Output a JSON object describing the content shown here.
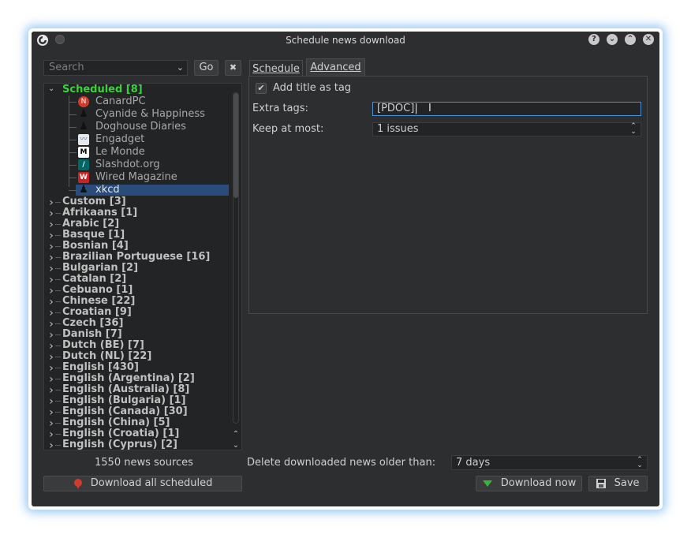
{
  "window": {
    "title": "Schedule news download"
  },
  "titlebar": {
    "help": "?",
    "minimize": "⌄",
    "maximize": "⌃",
    "close": "✕"
  },
  "search": {
    "placeholder": "Search",
    "go_label": "Go",
    "clear_label": "✖"
  },
  "tabs": [
    {
      "label": "Schedule"
    },
    {
      "label": "Advanced"
    }
  ],
  "advanced": {
    "add_title_label": "Add title as tag",
    "add_title_checked": true,
    "extra_tags_label": "Extra  tags:",
    "extra_tags_value": "[PDOC]",
    "keep_at_most_label": "Keep at most:",
    "keep_at_most_value": "1 issues"
  },
  "tree": {
    "scheduled": {
      "label": "Scheduled [8]",
      "items": [
        {
          "label": "CanardPC",
          "icon": "canardpc-icon",
          "color": "#d23b2c"
        },
        {
          "label": "Cyanide & Happiness",
          "icon": "user-icon",
          "color": "#1a1a1a"
        },
        {
          "label": "Doghouse Diaries",
          "icon": "user-icon",
          "color": "#1a1a1a"
        },
        {
          "label": "Engadget",
          "icon": "rss-icon",
          "color": "#e8e8e8"
        },
        {
          "label": "Le Monde",
          "icon": "lemonde-icon",
          "color": "#ffffff"
        },
        {
          "label": "Slashdot.org",
          "icon": "slashdot-icon",
          "color": "#006666"
        },
        {
          "label": "Wired Magazine",
          "icon": "wired-icon",
          "color": "#cc2222"
        },
        {
          "label": "xkcd",
          "icon": "user-icon",
          "color": "#1a1a1a",
          "selected": true
        }
      ]
    },
    "categories": [
      "Custom [3]",
      "Afrikaans [1]",
      "Arabic [2]",
      "Basque [1]",
      "Bosnian [4]",
      "Brazilian Portuguese [16]",
      "Bulgarian [2]",
      "Catalan [2]",
      "Cebuano [1]",
      "Chinese [22]",
      "Croatian [9]",
      "Czech [36]",
      "Danish [7]",
      "Dutch (BE) [7]",
      "Dutch (NL) [22]",
      "English [430]",
      "English (Argentina) [2]",
      "English (Australia) [8]",
      "English (Bulgaria) [1]",
      "English (Canada) [30]",
      "English (China) [5]",
      "English (Croatia) [1]",
      "English (Cyprus) [2]"
    ]
  },
  "footer": {
    "sources_count": "1550 news sources",
    "delete_label": "Delete downloaded news older than:",
    "delete_value": "7 days",
    "download_all_label": "Download all scheduled",
    "download_now_label": "Download now",
    "save_label": "Save"
  },
  "colors": {
    "accent": "#2a4c7a",
    "scheduled_green": "#3ad23a",
    "window_bg": "#2d2e30"
  }
}
